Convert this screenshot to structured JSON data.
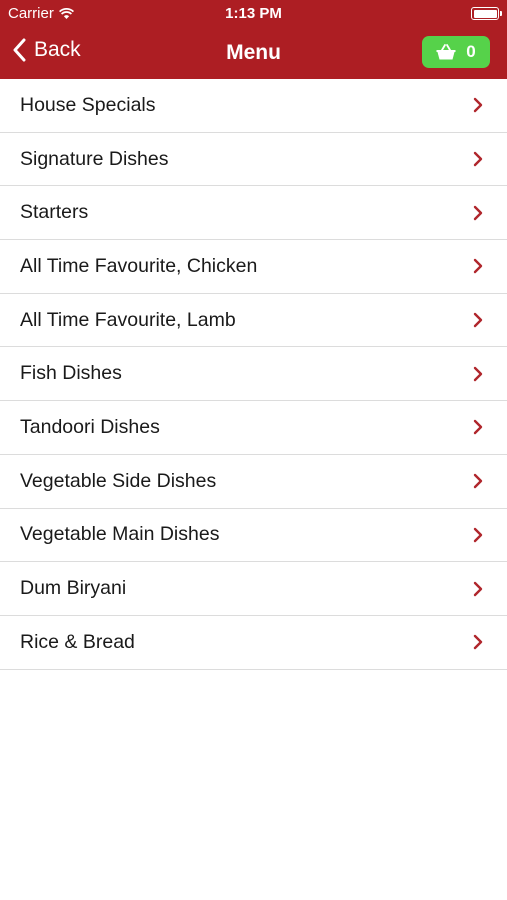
{
  "status_bar": {
    "carrier": "Carrier",
    "time": "1:13 PM"
  },
  "nav": {
    "back_label": "Back",
    "title": "Menu",
    "cart_count": "0"
  },
  "menu": {
    "items": [
      {
        "label": "House Specials"
      },
      {
        "label": "Signature Dishes"
      },
      {
        "label": "Starters"
      },
      {
        "label": "All Time Favourite, Chicken"
      },
      {
        "label": "All Time Favourite, Lamb"
      },
      {
        "label": "Fish Dishes"
      },
      {
        "label": "Tandoori Dishes"
      },
      {
        "label": "Vegetable Side Dishes"
      },
      {
        "label": "Vegetable Main Dishes"
      },
      {
        "label": "Dum Biryani"
      },
      {
        "label": "Rice & Bread"
      }
    ]
  },
  "colors": {
    "header_bg": "#ad1e23",
    "cart_bg": "#56d24a",
    "chevron": "#b0262c"
  },
  "icons": [
    "wifi-icon",
    "battery-icon",
    "back-chevron-icon",
    "basket-icon",
    "chevron-right-icon"
  ]
}
